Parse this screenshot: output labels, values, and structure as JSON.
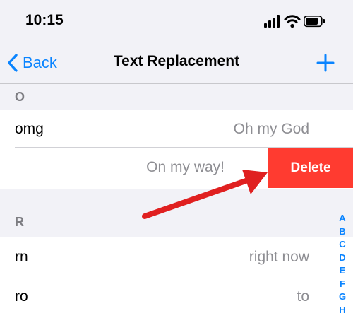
{
  "status_bar": {
    "time": "10:15",
    "icons": [
      "signal-icon",
      "wifi-icon",
      "battery-icon"
    ]
  },
  "nav": {
    "back_label": "Back",
    "title": "Text Replacement",
    "add_icon": "plus-icon"
  },
  "sections": [
    {
      "letter": "O",
      "rows": [
        {
          "phrase": "omg",
          "shortcut": "Oh my God"
        },
        {
          "phrase": "",
          "shortcut": "On my way!",
          "swiped": true
        }
      ]
    },
    {
      "letter": "R",
      "rows": [
        {
          "phrase": "rn",
          "shortcut": "right now"
        },
        {
          "phrase": "ro",
          "shortcut": "to"
        }
      ]
    }
  ],
  "delete_label": "Delete",
  "index": [
    "A",
    "B",
    "C",
    "D",
    "E",
    "F",
    "G",
    "H"
  ],
  "colors": {
    "accent": "#0a84ff",
    "delete": "#ff3b30",
    "annotation_arrow": "#e02020",
    "background": "#f2f2f7"
  }
}
